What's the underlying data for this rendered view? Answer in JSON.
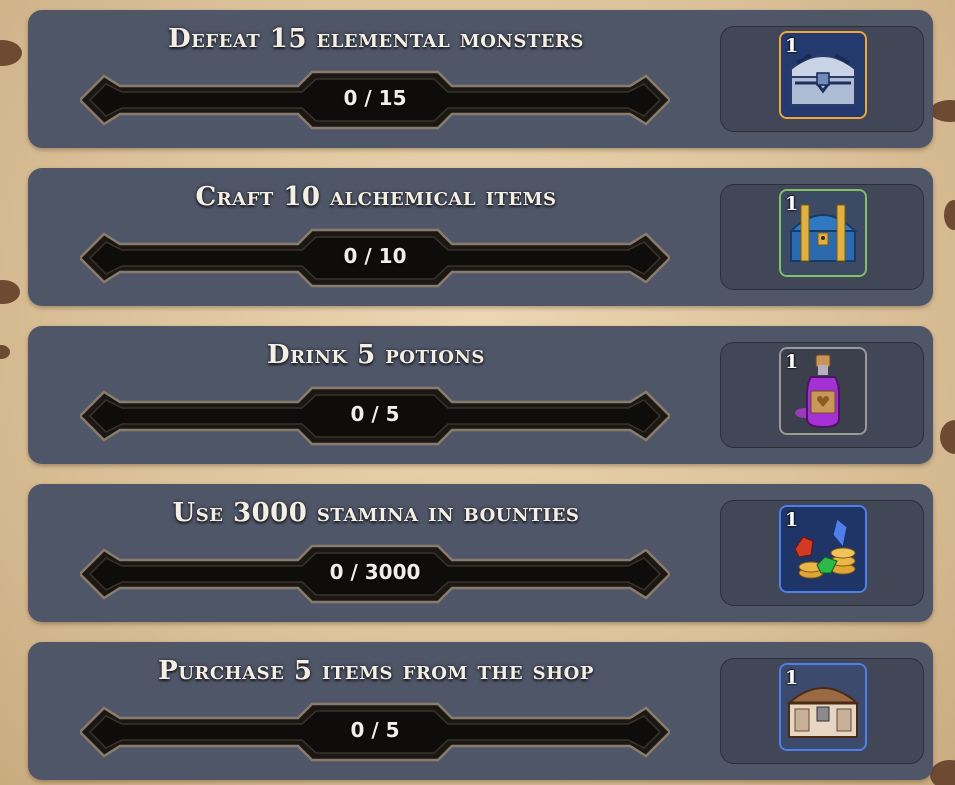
{
  "quests": [
    {
      "title": "Defeat 15 elemental monsters",
      "progress_text": "0 / 15",
      "progress": 0,
      "reward": {
        "count": "1",
        "icon": "silver-chest-icon",
        "rarity_color": "#f0a63a"
      }
    },
    {
      "title": "Craft 10 alchemical items",
      "progress_text": "0 / 10",
      "progress": 0,
      "reward": {
        "count": "1",
        "icon": "blue-chest-icon",
        "rarity_color": "#7fc26a"
      }
    },
    {
      "title": "Drink 5 potions",
      "progress_text": "0 / 5",
      "progress": 0,
      "reward": {
        "count": "1",
        "icon": "purple-potion-icon",
        "rarity_color": "#9a9a9a"
      }
    },
    {
      "title": "Use 3000 stamina in bounties",
      "progress_text": "0 / 3000",
      "progress": 0,
      "reward": {
        "count": "1",
        "icon": "gems-and-coins-icon",
        "rarity_color": "#4f7fe8"
      }
    },
    {
      "title": "Purchase 5 items from the shop",
      "progress_text": "0 / 5",
      "progress": 0,
      "reward": {
        "count": "1",
        "icon": "wooden-chest-icon",
        "rarity_color": "#4f7fe8"
      }
    }
  ]
}
